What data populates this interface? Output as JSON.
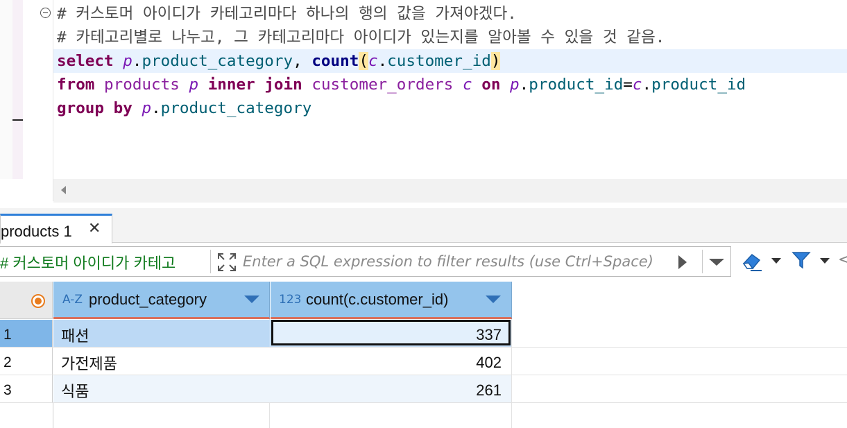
{
  "editor": {
    "lines": [
      {
        "comment": "# 커스토머 아이디가 카테고리마다 하나의 행의 값을 가져야겠다."
      },
      {
        "comment": "# 카테고리별로 나누고, 그 카테고리마다 아이디가 있는지를 알아볼 수 있을 것 같음."
      }
    ],
    "sql": {
      "select_kw": "select",
      "alias_p": "p",
      "dot": ".",
      "col_category": "product_category",
      "comma": ",",
      "count_fn": "count",
      "open_paren": "(",
      "alias_c": "c",
      "col_customer_id": "customer_id",
      "close_paren": ")",
      "from_kw": "from",
      "tbl_products": "products",
      "inner_kw": "inner",
      "join_kw": "join",
      "tbl_orders": "customer_orders",
      "on_kw": "on",
      "col_product_id": "product_id",
      "eq": "=",
      "group_kw": "group",
      "by_kw": "by"
    }
  },
  "results_tab": {
    "label": "products 1",
    "close_glyph": "✕"
  },
  "filter": {
    "history_text": "# 커스토머 아이디가 카테고",
    "placeholder": "Enter a SQL expression to filter results (use Ctrl+Space)",
    "more_glyph": "<"
  },
  "grid": {
    "columns": [
      {
        "type_icon": "A-Z",
        "label": "product_category"
      },
      {
        "type_icon": "123",
        "label": "count(c.customer_id)"
      }
    ],
    "rows": [
      {
        "num": "1",
        "category": "패션",
        "count": "337"
      },
      {
        "num": "2",
        "category": "가전제품",
        "count": "402"
      },
      {
        "num": "3",
        "category": "식품",
        "count": "261"
      }
    ]
  },
  "colors": {
    "accent": "#2f7fd9",
    "header_bg": "#94c4ec",
    "keyword": "#7f0055",
    "history_text": "#0f7a1c"
  }
}
